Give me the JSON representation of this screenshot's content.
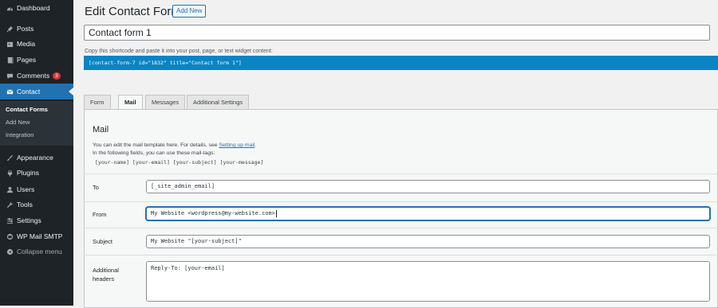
{
  "sidebar": {
    "items": [
      {
        "label": "Dashboard",
        "icon": "dashboard-icon"
      },
      {
        "label": "Posts",
        "icon": "pin-icon"
      },
      {
        "label": "Media",
        "icon": "media-icon"
      },
      {
        "label": "Pages",
        "icon": "page-icon"
      },
      {
        "label": "Comments",
        "icon": "comment-icon",
        "badge": "3"
      },
      {
        "label": "Contact",
        "icon": "mail-icon"
      },
      {
        "label": "Appearance",
        "icon": "brush-icon"
      },
      {
        "label": "Plugins",
        "icon": "plug-icon"
      },
      {
        "label": "Users",
        "icon": "user-icon"
      },
      {
        "label": "Tools",
        "icon": "wrench-icon"
      },
      {
        "label": "Settings",
        "icon": "settings-icon"
      },
      {
        "label": "WP Mail SMTP",
        "icon": "smtp-icon"
      },
      {
        "label": "Collapse menu",
        "icon": "collapse-icon"
      }
    ],
    "submenu": [
      {
        "label": "Contact Forms"
      },
      {
        "label": "Add New"
      },
      {
        "label": "Integration"
      }
    ]
  },
  "header": {
    "title": "Edit Contact Form",
    "add_new": "Add New"
  },
  "form_title": "Contact form 1",
  "shortcode": {
    "hint": "Copy this shortcode and paste it into your post, page, or text widget content:",
    "code": "[contact-form-7 id=\"1832\" title=\"Contact form 1\"]"
  },
  "tabs": [
    {
      "label": "Form"
    },
    {
      "label": "Mail"
    },
    {
      "label": "Messages"
    },
    {
      "label": "Additional Settings"
    }
  ],
  "mail": {
    "heading": "Mail",
    "desc1_prefix": "You can edit the mail template here. For details, see ",
    "desc1_link": "Setting up mail",
    "desc1_suffix": ".",
    "desc2": "In the following fields, you can use these mail-tags:",
    "tags": "[your-name] [your-email] [your-subject] [your-message]",
    "fields": {
      "to": {
        "label": "To",
        "value": "[_site_admin_email]"
      },
      "from": {
        "label": "From",
        "value": "My Website <wordpress@my-website.com>"
      },
      "subject": {
        "label": "Subject",
        "value": "My Website \"[your-subject]\""
      },
      "headers": {
        "label_line1": "Additional",
        "label_line2": "headers",
        "value": "Reply-To: [your-email]"
      }
    }
  },
  "colors": {
    "sidebar_bg": "#1d2327",
    "accent": "#2271b1",
    "shortcode_bg": "#0a84c3",
    "badge": "#d63638"
  }
}
